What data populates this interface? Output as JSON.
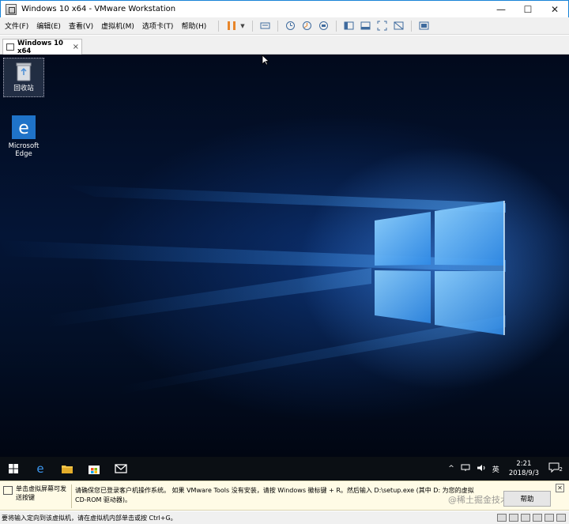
{
  "window": {
    "title": "Windows 10 x64 - VMware Workstation",
    "controls": {
      "minimize": "—",
      "maximize": "☐",
      "close": "✕"
    }
  },
  "menu": {
    "items": [
      "文件(F)",
      "编辑(E)",
      "查看(V)",
      "虚拟机(M)",
      "选项卡(T)",
      "帮助(H)"
    ]
  },
  "toolbar": {
    "icons": [
      "pause-icon",
      "send-keys-icon",
      "snapshot-icon",
      "revert-snapshot-icon",
      "snapshot-manager-icon",
      "library-icon",
      "thumbnail-icon",
      "fullscreen-icon",
      "unity-icon",
      "console-view-icon"
    ],
    "accent": "#e8862b"
  },
  "tabs": [
    {
      "label": "Windows 10 x64",
      "close": "×"
    }
  ],
  "desktop": {
    "icons": [
      {
        "label": "回收站",
        "icon": "recycle-bin-icon"
      },
      {
        "label": "Microsoft Edge",
        "icon": "edge-icon"
      }
    ]
  },
  "taskbar": {
    "apps": [
      "start-icon",
      "edge-icon",
      "file-explorer-icon",
      "store-icon",
      "mail-icon"
    ],
    "tray": {
      "chevron": "^",
      "ime": "英",
      "time": "2:21",
      "date": "2018/9/3",
      "notifications": "2"
    }
  },
  "notice": {
    "left_text": "单击虚拟屏幕可发送按键",
    "message": "请确保您已登录客户机操作系统。 如果 VMware Tools 没有安装，请按 Windows 徽标键 + R。然后输入 D:\\setup.exe (其中 D: 为您的虚拟 CD-ROM 驱动器)。",
    "help_label": "帮助",
    "close": "✕",
    "watermark": "@稀土掘金技术社区"
  },
  "status": {
    "text": "要将输入定向到该虚拟机，请在虚拟机内部单击或按 Ctrl+G。"
  }
}
